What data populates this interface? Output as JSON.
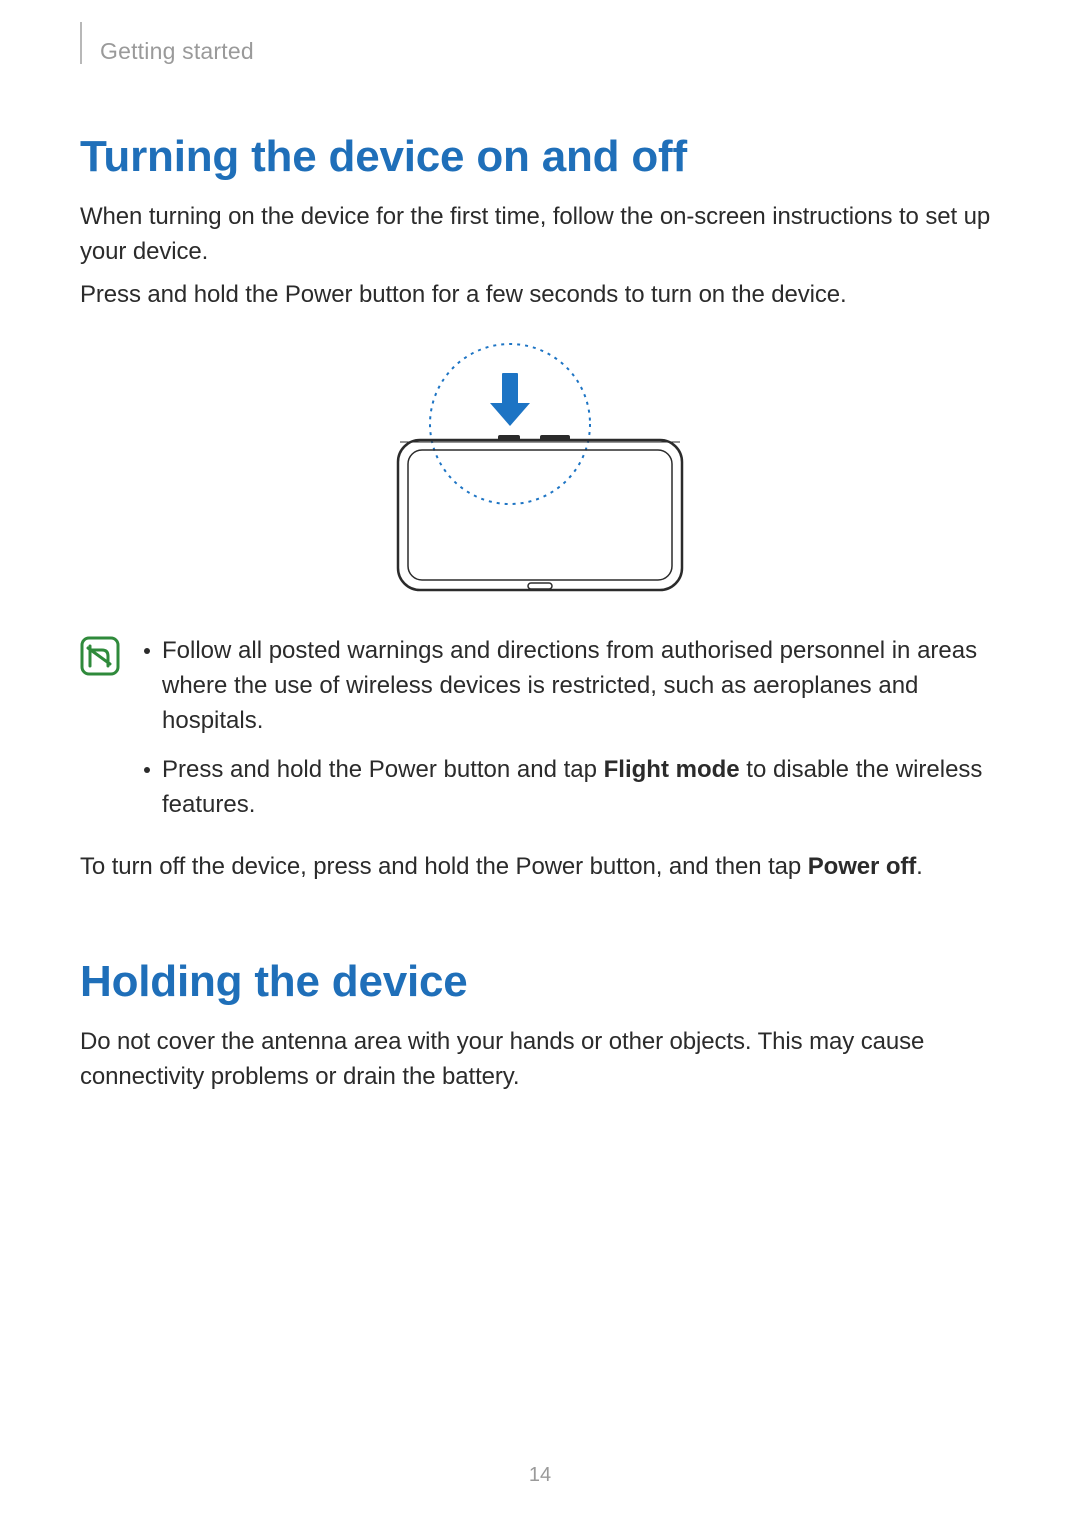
{
  "header": {
    "section_label": "Getting started"
  },
  "sections": [
    {
      "title": "Turning the device on and off",
      "paragraphs": [
        "When turning on the device for the first time, follow the on-screen instructions to set up your device.",
        "Press and hold the Power button for a few seconds to turn on the device."
      ],
      "notes": [
        {
          "pre": "Follow all posted warnings and directions from authorised personnel in areas where the use of wireless devices is restricted, such as aeroplanes and hospitals.",
          "bold": "",
          "post": ""
        },
        {
          "pre": "Press and hold the Power button and tap ",
          "bold": "Flight mode",
          "post": " to disable the wireless features."
        }
      ],
      "closing": {
        "pre": "To turn off the device, press and hold the Power button, and then tap ",
        "bold": "Power off",
        "post": "."
      }
    },
    {
      "title": "Holding the device",
      "paragraphs": [
        "Do not cover the antenna area with your hands or other objects. This may cause connectivity problems or drain the battery."
      ]
    }
  ],
  "page_number": "14"
}
